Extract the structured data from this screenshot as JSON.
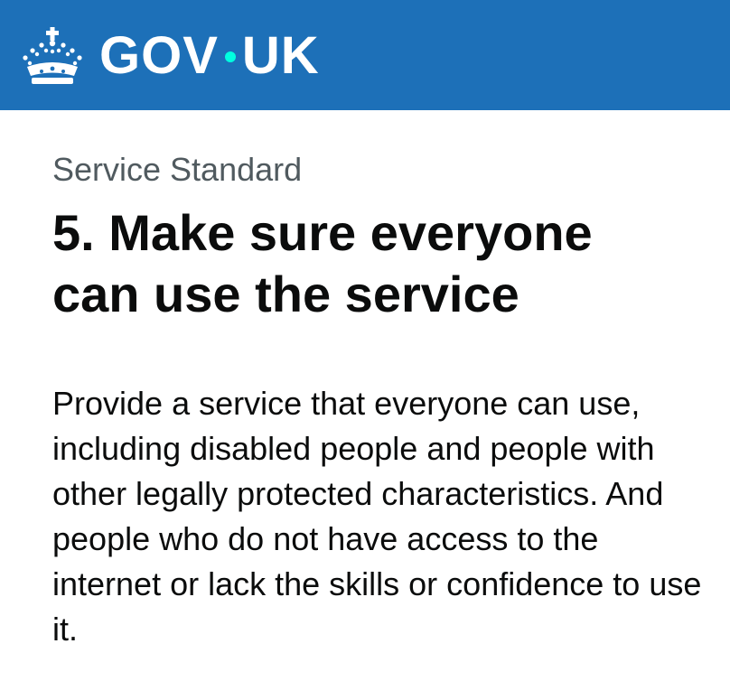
{
  "header": {
    "logo_word_left": "GOV",
    "logo_word_right": "UK",
    "logo_dot_color": "#00ffe0",
    "background_color": "#1d70b8",
    "crown_icon": "crown-icon"
  },
  "page": {
    "caption": "Service Standard",
    "title": "5. Make sure everyone can use the service",
    "lede": "Provide a service that everyone can use, including disabled people and people with other legally protected characteristics. And people who do not have access to the internet or lack the skills or confidence to use it."
  }
}
